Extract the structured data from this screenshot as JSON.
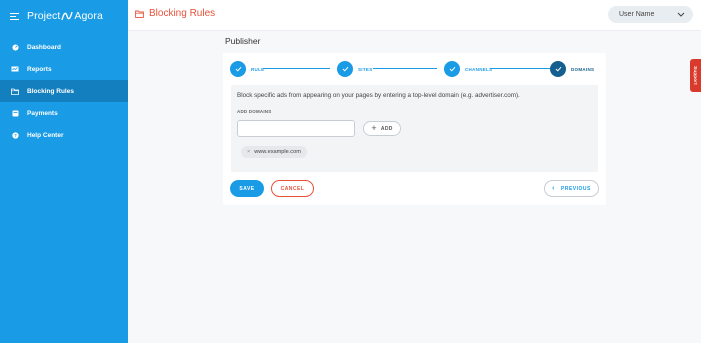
{
  "sidebar": {
    "logo": {
      "left": "Project",
      "right": "Agora"
    },
    "items": [
      {
        "label": "Dashboard",
        "icon": "dashboard-icon",
        "active": false
      },
      {
        "label": "Reports",
        "icon": "reports-icon",
        "active": false
      },
      {
        "label": "Blocking Rules",
        "icon": "folder-icon",
        "active": true
      },
      {
        "label": "Payments",
        "icon": "payments-icon",
        "active": false
      },
      {
        "label": "Help Center",
        "icon": "help-icon",
        "active": false
      }
    ]
  },
  "header": {
    "title": "Blocking Rules",
    "user_menu": {
      "label": "User Name"
    }
  },
  "main": {
    "section_title": "Publisher",
    "steps": [
      {
        "label": "RULE",
        "completed": true
      },
      {
        "label": "SITES",
        "completed": true
      },
      {
        "label": "CHANNELS",
        "completed": true
      },
      {
        "label": "DOMAINS",
        "completed": false,
        "current": true
      }
    ],
    "description": "Block specific ads from appearing on your pages by entering a top-level domain (e.g. advertiser.com).",
    "add_domains_label": "ADD DOMAINS",
    "domain_input": {
      "value": "",
      "placeholder": ""
    },
    "add_button": "ADD",
    "domains": [
      "www.example.com"
    ],
    "buttons": {
      "save": "SAVE",
      "cancel": "CANCEL",
      "previous": "PREVIOUS"
    }
  },
  "support_tab": "Support",
  "colors": {
    "primary": "#1a9be6",
    "active_nav": "#147fbf",
    "accent": "#e8523a",
    "current_step": "#145f8f"
  }
}
